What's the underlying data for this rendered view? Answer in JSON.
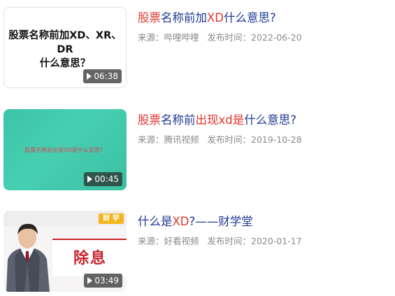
{
  "items": [
    {
      "thumb_text": [
        "股票名称前加XD、XR、DR",
        "什么意思？"
      ],
      "duration": "06:38",
      "title_parts": [
        {
          "text": "股票",
          "hl": true
        },
        {
          "text": "名称前加",
          "hl": false
        },
        {
          "text": "XD",
          "hl": true
        },
        {
          "text": "什么意思?",
          "hl": false
        }
      ],
      "source": "来源：哔哩哔哩",
      "date": "发布时间：2022-06-20"
    },
    {
      "thumb_text": [
        "股票名称前出现XD是什么意思？"
      ],
      "duration": "00:45",
      "title_parts": [
        {
          "text": "股票",
          "hl": true
        },
        {
          "text": "名称前",
          "hl": false
        },
        {
          "text": "出现xd是",
          "hl": true
        },
        {
          "text": "什么意思?",
          "hl": false
        }
      ],
      "source": "来源：腾讯视频",
      "date": "发布时间：2019-10-28"
    },
    {
      "thumb_badge": "财 学",
      "thumb_text": [
        "除息"
      ],
      "duration": "03:49",
      "title_parts": [
        {
          "text": "什么是",
          "hl": false
        },
        {
          "text": "XD",
          "hl": true
        },
        {
          "text": "?——财学堂",
          "hl": false
        }
      ],
      "source": "来源：好看视频",
      "date": "发布时间：2020-01-17"
    }
  ],
  "colors": {
    "title": "#1f3a93",
    "highlight": "#e0342f",
    "meta": "#8a8a8a",
    "thumb2_bg": "#44c9ad",
    "duration_bg": "rgba(40,40,40,0.72)"
  },
  "icons": {
    "duration": "play-triangle-icon"
  }
}
